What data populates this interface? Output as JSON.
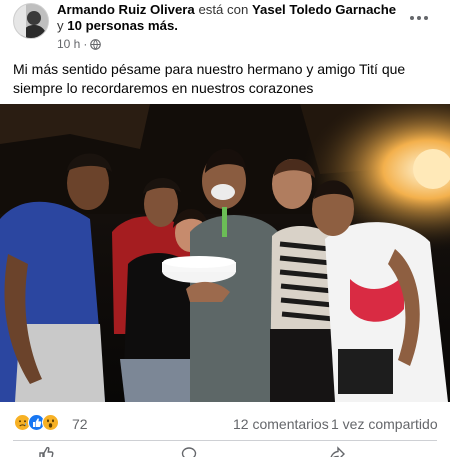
{
  "post": {
    "author": "Armando Ruiz Olivera",
    "with_text": "está con",
    "tagged_person": "Yasel Toledo Garnache",
    "and_text": "y",
    "others": "10 personas más.",
    "time": "10 h",
    "privacy_icon": "globe-icon",
    "more_icon": "more-options-icon",
    "text": "Mi más sentido pésame para nuestro hermano y amigo Tití que siempre lo recordaremos en nuestros corazones"
  },
  "photo": {
    "icon": "photo-group-image"
  },
  "stats": {
    "reactions": [
      "sad",
      "like",
      "wow"
    ],
    "reaction_count": "72",
    "comments": "12 comentarios",
    "shares": "1 vez compartido"
  },
  "colors": {
    "like": "#1877f2",
    "sad": "#f7b125",
    "wow": "#f7b125",
    "secondary_text": "#65676b",
    "divider": "#ced0d4"
  }
}
